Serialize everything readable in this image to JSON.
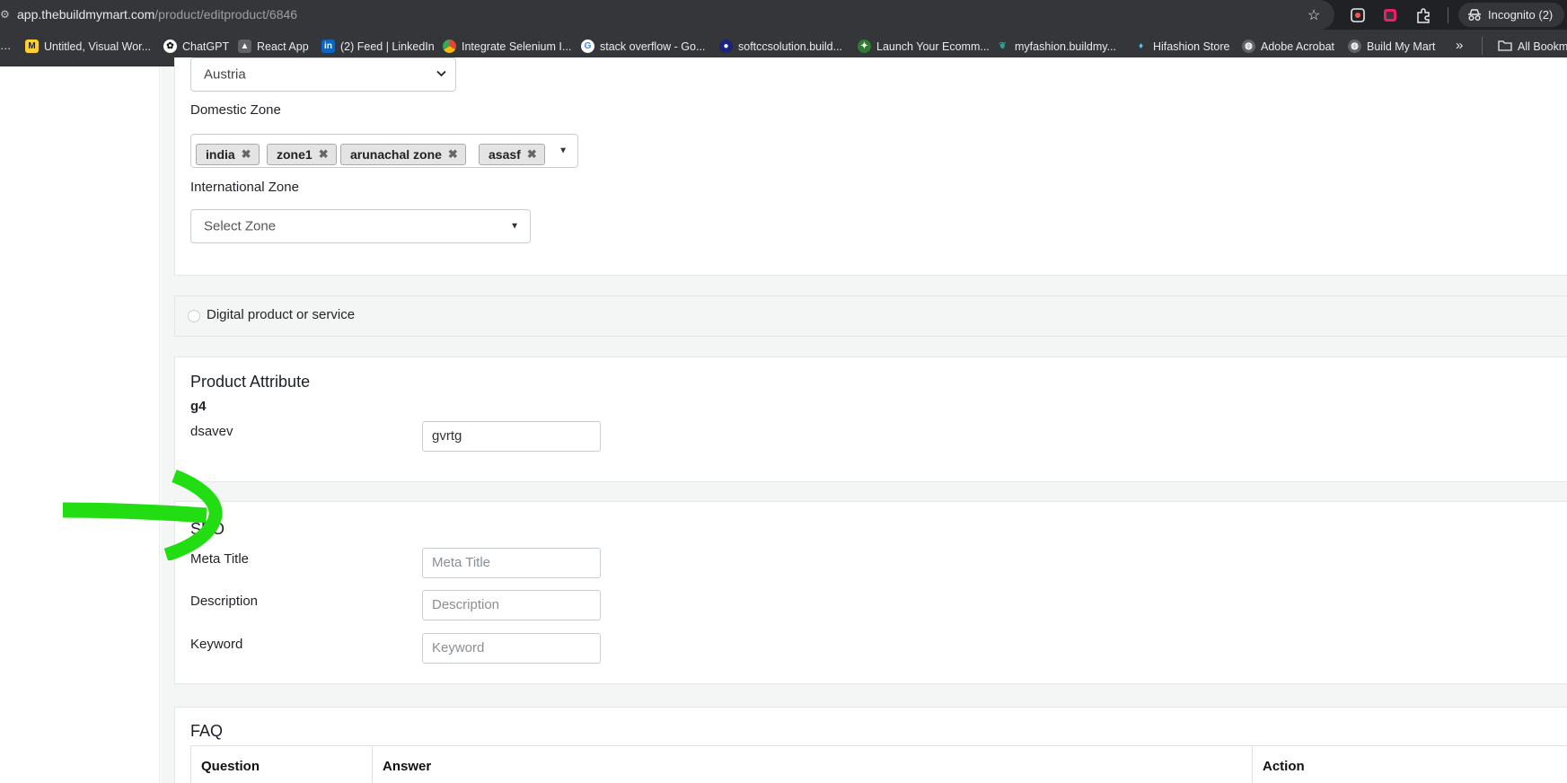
{
  "browser": {
    "url_host": "app.thebuildmymart.com",
    "url_path": "/product/editproduct/6846",
    "incognito_label": "Incognito (2)",
    "bookmarks": [
      {
        "label": "Untitled, Visual Wor...",
        "icon": "miro-icon",
        "color": "#ffd02f"
      },
      {
        "label": "ChatGPT",
        "icon": "chatgpt-icon",
        "color": "#ffffff"
      },
      {
        "label": "React App",
        "icon": "react-icon",
        "color": "#9aa0a6"
      },
      {
        "label": "(2) Feed | LinkedIn",
        "icon": "linkedin-icon",
        "color": "#0a66c2"
      },
      {
        "label": "Integrate Selenium I...",
        "icon": "chrome-icon",
        "color": "#ea4335"
      },
      {
        "label": "stack overflow - Go...",
        "icon": "google-icon",
        "color": "#4285f4"
      },
      {
        "label": "softccsolution.build...",
        "icon": "site-icon",
        "color": "#1a237e"
      },
      {
        "label": "Launch Your Ecomm...",
        "icon": "site-icon",
        "color": "#2e7d32"
      },
      {
        "label": "myfashion.buildmy...",
        "icon": "site-icon",
        "color": "#26a69a"
      },
      {
        "label": "Hifashion Store",
        "icon": "site-icon",
        "color": "#4fc3f7"
      },
      {
        "label": "Adobe Acrobat",
        "icon": "globe-icon",
        "color": "#9aa0a6"
      },
      {
        "label": "Build My Mart",
        "icon": "globe-icon",
        "color": "#9aa0a6"
      }
    ],
    "more_bookmarks": "»",
    "all_bookmarks_label": "All Bookm"
  },
  "shipping": {
    "country_value": "Austria",
    "domestic_zone_label": "Domestic Zone",
    "domestic_zones": [
      "india",
      "zone1",
      "arunachal zone",
      "asasf"
    ],
    "international_zone_label": "International Zone",
    "international_zone_placeholder": "Select Zone"
  },
  "digital": {
    "label": "Digital product or service"
  },
  "attributes": {
    "heading": "Product Attribute",
    "group": "g4",
    "name": "dsavev",
    "value": "gvrtg"
  },
  "seo": {
    "heading": "SEO",
    "meta_title_label": "Meta Title",
    "meta_title_placeholder": "Meta Title",
    "description_label": "Description",
    "description_placeholder": "Description",
    "keyword_label": "Keyword",
    "keyword_placeholder": "Keyword"
  },
  "faq": {
    "heading": "FAQ",
    "columns": [
      "Question",
      "Answer",
      "Action"
    ]
  },
  "colors": {
    "annotation_arrow": "#22dd11"
  }
}
